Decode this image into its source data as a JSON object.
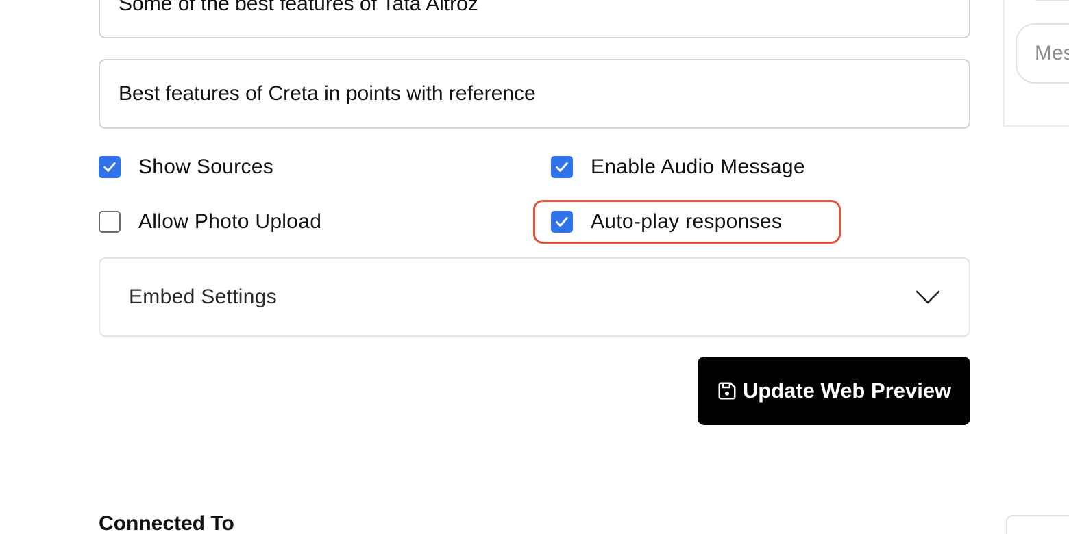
{
  "prompts": {
    "first": "Some of the best features of Tata Altroz",
    "second": "Best features of Creta in points with reference"
  },
  "options": {
    "show_sources": {
      "label": "Show Sources",
      "checked": true
    },
    "enable_audio_message": {
      "label": "Enable Audio Message",
      "checked": true
    },
    "allow_photo_upload": {
      "label": "Allow Photo Upload",
      "checked": false
    },
    "auto_play_responses": {
      "label": "Auto-play responses",
      "checked": true
    }
  },
  "embed_settings": {
    "label": "Embed Settings",
    "icon": "chevron-down-icon"
  },
  "update_button": {
    "label": "Update Web Preview",
    "icon": "save-icon"
  },
  "connected_section": {
    "title": "Connected To"
  },
  "chat_preview": {
    "message_placeholder": "Message"
  },
  "colors": {
    "checkbox_checked": "#2f72ea",
    "highlight": "#e0533a",
    "primary_button": "#000000"
  }
}
